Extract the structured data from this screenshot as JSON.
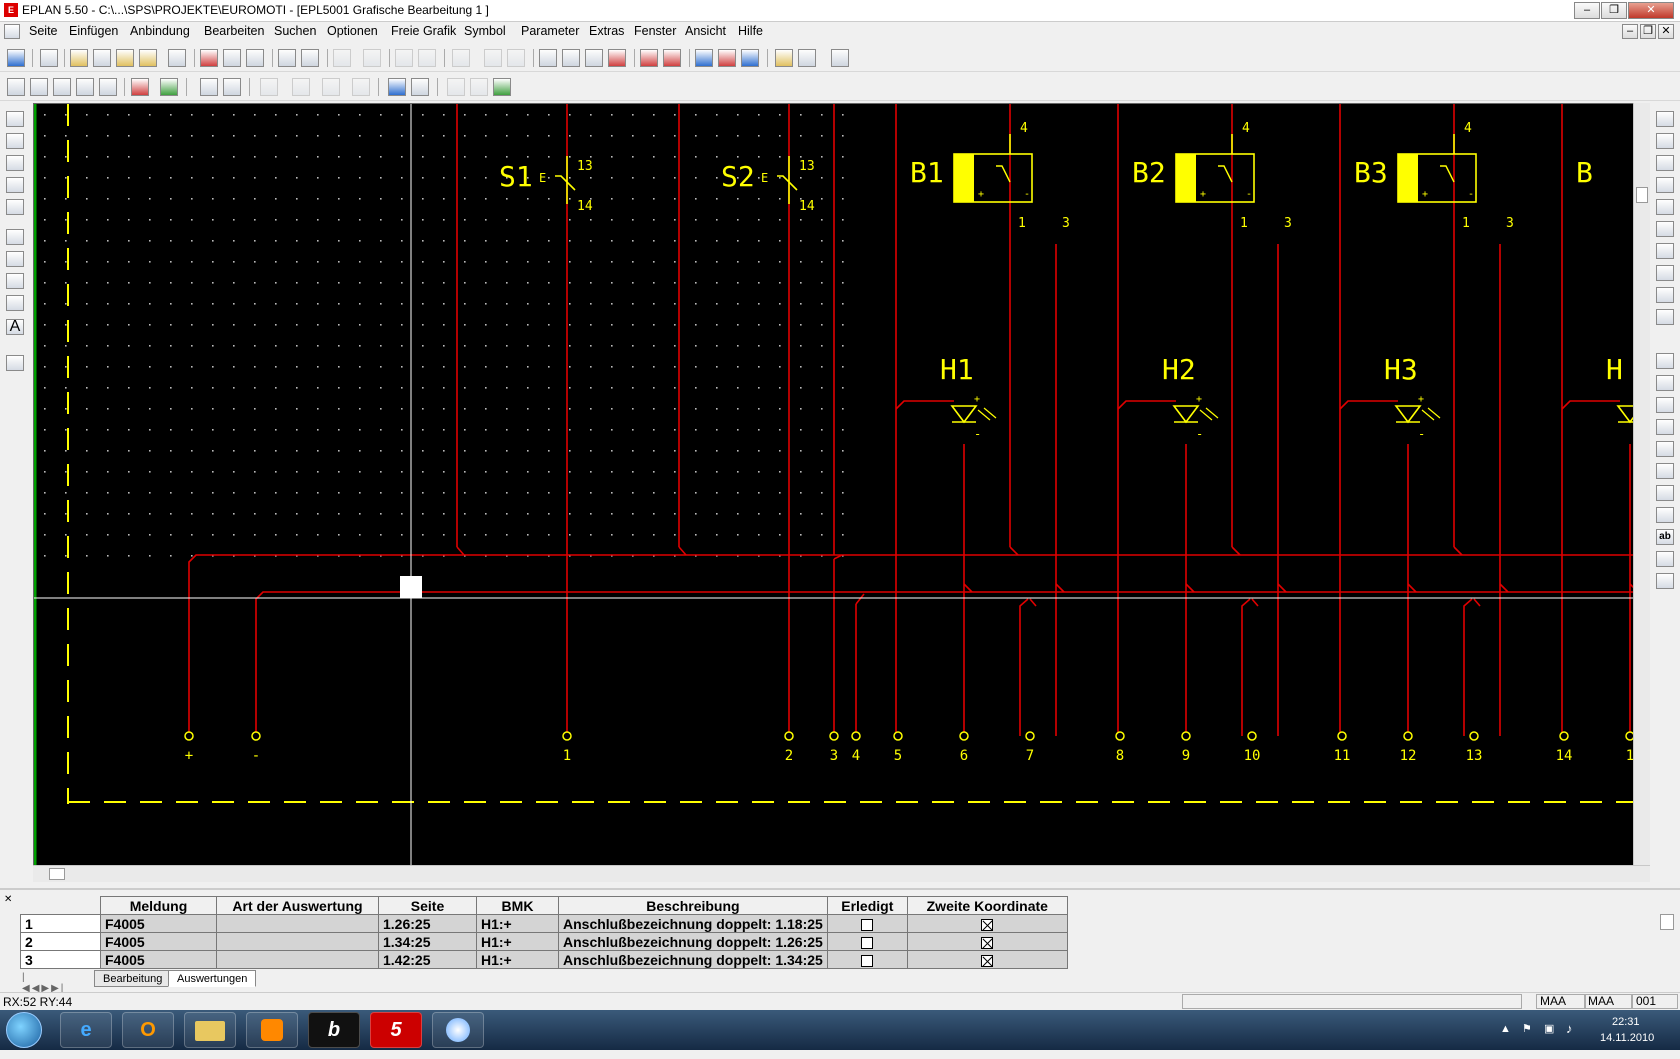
{
  "window": {
    "title": "EPLAN 5.50 - C:\\...\\SPS\\PROJEKTE\\EUROMOTI - [EPL5001 Grafische Bearbeitung 1  ]",
    "app_icon": "E"
  },
  "menu": [
    "Seite",
    "Einfügen",
    "Anbindung",
    "Bearbeiten",
    "Suchen",
    "Optionen",
    "Freie Grafik",
    "Symbol",
    "Parameter",
    "Extras",
    "Fenster",
    "Ansicht",
    "Hilfe"
  ],
  "schematic": {
    "switches": [
      {
        "label": "S1",
        "pin_top": "13",
        "pin_bottom": "14",
        "mark": "E"
      },
      {
        "label": "S2",
        "pin_top": "13",
        "pin_bottom": "14",
        "mark": "E"
      }
    ],
    "sensors": [
      {
        "label": "B1",
        "pin_top": "4",
        "pin_left": "1",
        "pin_right": "3"
      },
      {
        "label": "B2",
        "pin_top": "4",
        "pin_left": "1",
        "pin_right": "3"
      },
      {
        "label": "B3",
        "pin_top": "4",
        "pin_left": "1",
        "pin_right": "3"
      },
      {
        "label": "B",
        "pin_top": "",
        "pin_left": "",
        "pin_right": ""
      }
    ],
    "lamps": [
      {
        "label": "H1"
      },
      {
        "label": "H2"
      },
      {
        "label": "H3"
      },
      {
        "label": "H"
      }
    ],
    "terminals": [
      "+",
      "-",
      "1",
      "2",
      "3",
      "4",
      "5",
      "6",
      "7",
      "8",
      "9",
      "10",
      "11",
      "12",
      "13",
      "14",
      "1"
    ],
    "colors": {
      "wire": "#e00000",
      "symbol": "#ffff00",
      "background": "#000000",
      "grid": "#bbbbbb"
    }
  },
  "table": {
    "headers": [
      "Meldung",
      "Art der Auswertung",
      "Seite",
      "BMK",
      "Beschreibung",
      "Erledigt",
      "Zweite Koordinate"
    ],
    "rows": [
      {
        "n": "1",
        "meldung": "F4005",
        "art": "",
        "seite": "1.26:25",
        "bmk": "H1:+",
        "beschr": "Anschlußbezeichnung doppelt: 1.18:25",
        "erledigt": false,
        "zweite": true
      },
      {
        "n": "2",
        "meldung": "F4005",
        "art": "",
        "seite": "1.34:25",
        "bmk": "H1:+",
        "beschr": "Anschlußbezeichnung doppelt: 1.26:25",
        "erledigt": false,
        "zweite": true
      },
      {
        "n": "3",
        "meldung": "F4005",
        "art": "",
        "seite": "1.42:25",
        "bmk": "H1:+",
        "beschr": "Anschlußbezeichnung doppelt: 1.34:25",
        "erledigt": false,
        "zweite": true
      }
    ]
  },
  "tabs": [
    "Bearbeitung",
    "Auswertungen"
  ],
  "status": {
    "coords": "RX:52 RY:44",
    "field1": "MAA",
    "field2": "MAA",
    "field3": "001"
  },
  "taskbar": {
    "time": "22:31",
    "date": "14.11.2010",
    "apps": [
      "e",
      "O",
      "folder",
      "media",
      "b",
      "5",
      "paint"
    ]
  }
}
